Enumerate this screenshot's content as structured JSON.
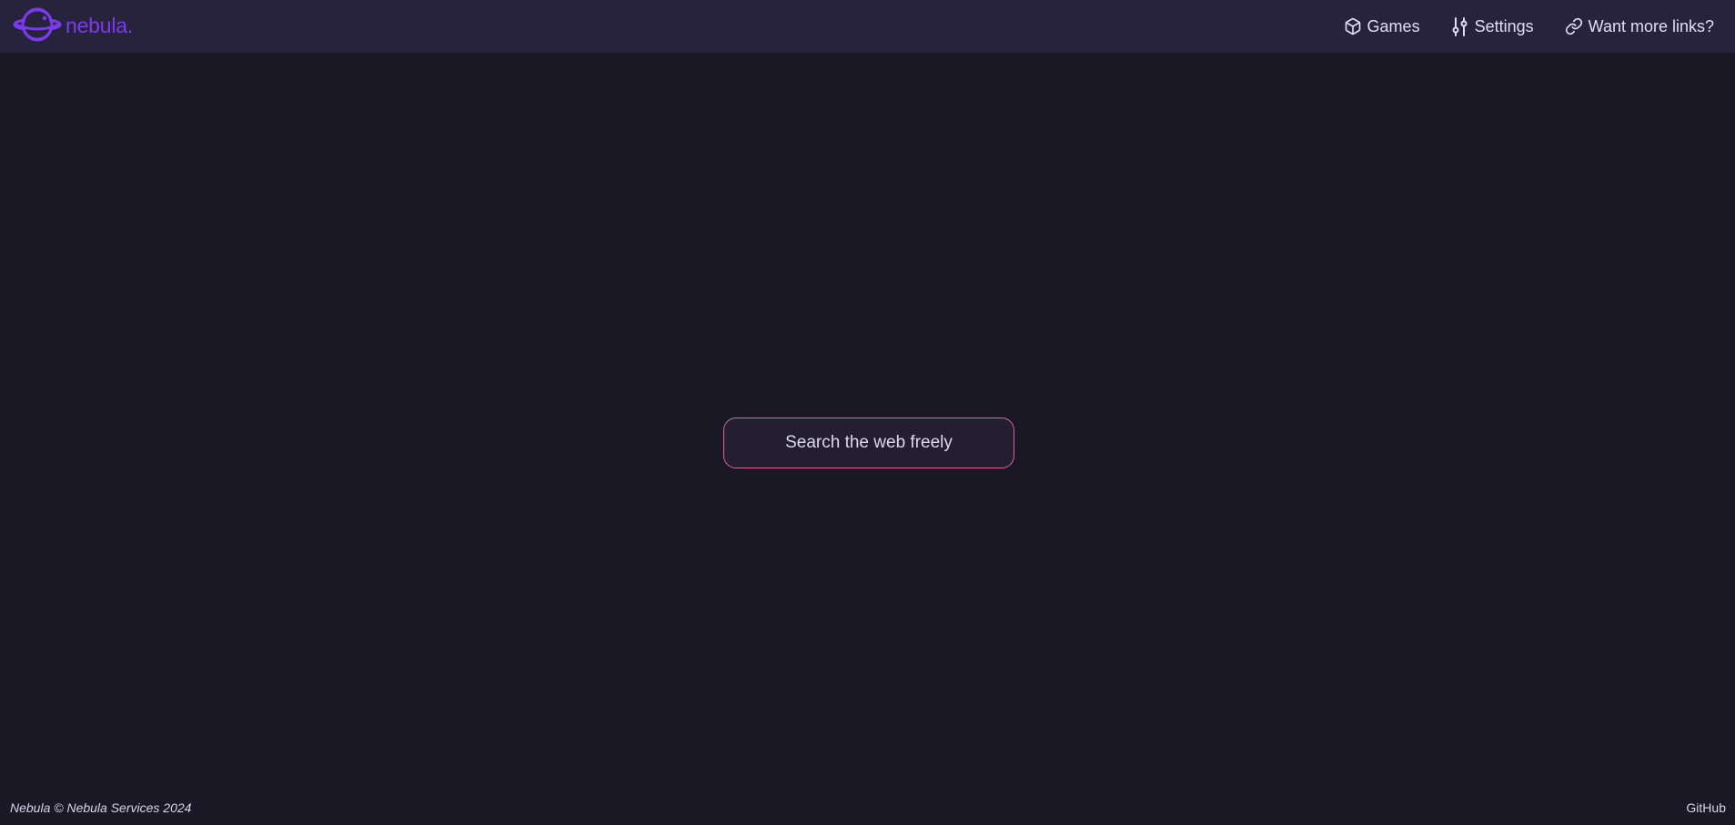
{
  "brand": {
    "name": "nebula.",
    "logo_icon": "planet-icon",
    "color": "#7c3aed"
  },
  "nav": {
    "items": [
      {
        "label": "Games",
        "icon": "cube-icon"
      },
      {
        "label": "Settings",
        "icon": "sliders-icon"
      },
      {
        "label": "Want more links?",
        "icon": "link-icon"
      }
    ]
  },
  "search": {
    "placeholder": "Search the web freely",
    "value": "",
    "border_color": "#e0609b"
  },
  "footer": {
    "copyright": "Nebula © Nebula Services 2024",
    "github_label": "GitHub"
  },
  "colors": {
    "background": "#1b1825",
    "navbar": "#28233c",
    "text": "#e2dcf5"
  }
}
